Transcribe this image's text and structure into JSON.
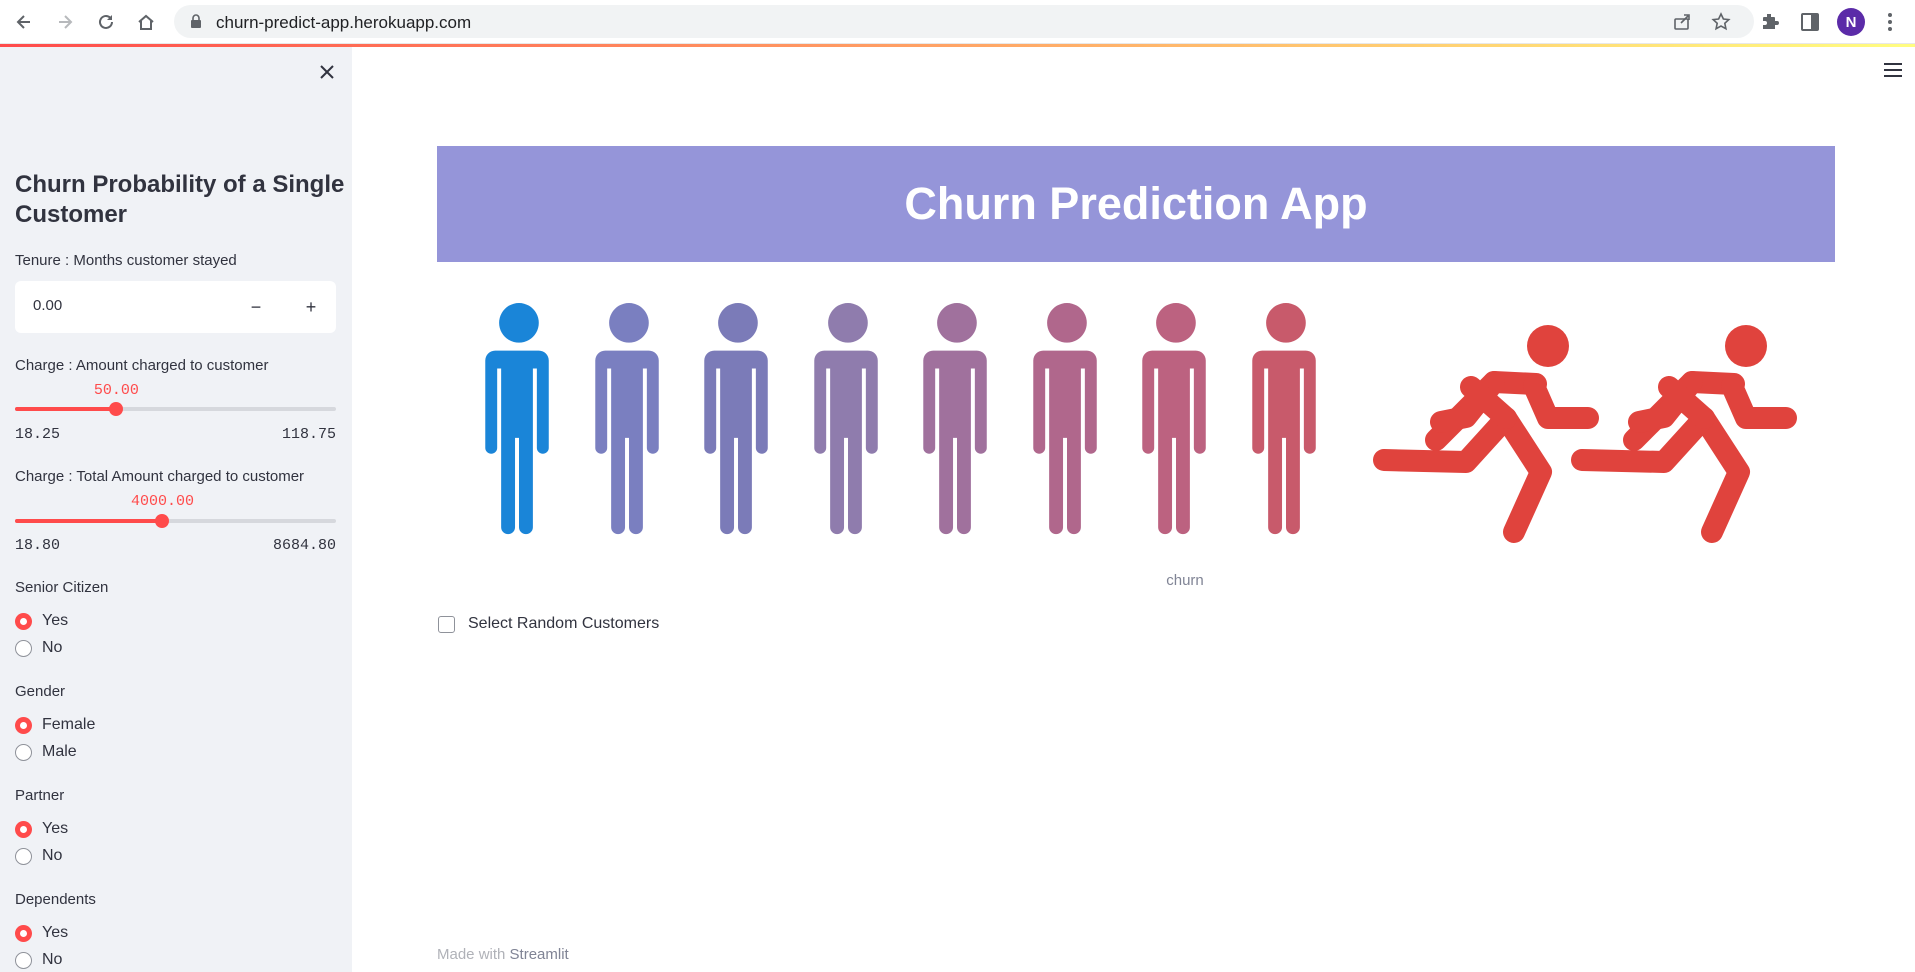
{
  "browser": {
    "url": "churn-predict-app.herokuapp.com",
    "avatar_letter": "N"
  },
  "sidebar": {
    "title": "Churn Probability of a Single Customer",
    "tenure": {
      "label": "Tenure : Months customer stayed",
      "value": "0.00",
      "minus": "−",
      "plus": "+"
    },
    "monthly_charge": {
      "label": "Charge : Amount charged to customer",
      "value_label": "50.00",
      "value": 50.0,
      "min_label": "18.25",
      "max_label": "118.75",
      "min": 18.25,
      "max": 118.75
    },
    "total_charge": {
      "label": "Charge : Total Amount charged to customer",
      "value_label": "4000.00",
      "value": 4000.0,
      "min_label": "18.80",
      "max_label": "8684.80",
      "min": 18.8,
      "max": 8684.8
    },
    "senior_citizen": {
      "label": "Senior Citizen",
      "options": [
        "Yes",
        "No"
      ],
      "selected": 0
    },
    "gender": {
      "label": "Gender",
      "options": [
        "Female",
        "Male"
      ],
      "selected": 0
    },
    "partner": {
      "label": "Partner",
      "options": [
        "Yes",
        "No"
      ],
      "selected": 0
    },
    "dependents": {
      "label": "Dependents",
      "options": [
        "Yes",
        "No"
      ],
      "selected": 0
    }
  },
  "main": {
    "banner_title": "Churn Prediction App",
    "image_caption": "churn",
    "checkbox_label": "Select Random Customers",
    "footer_prefix": "Made with ",
    "footer_brand": "Streamlit",
    "figure_colors": [
      "#1a85d8",
      "#7a7fc0",
      "#7b7bb8",
      "#8f7cad",
      "#a0719d",
      "#b0678c",
      "#bc6280",
      "#c85a6b"
    ],
    "runner_color": "#e0433d",
    "accent_color": "#ff4b4b"
  }
}
